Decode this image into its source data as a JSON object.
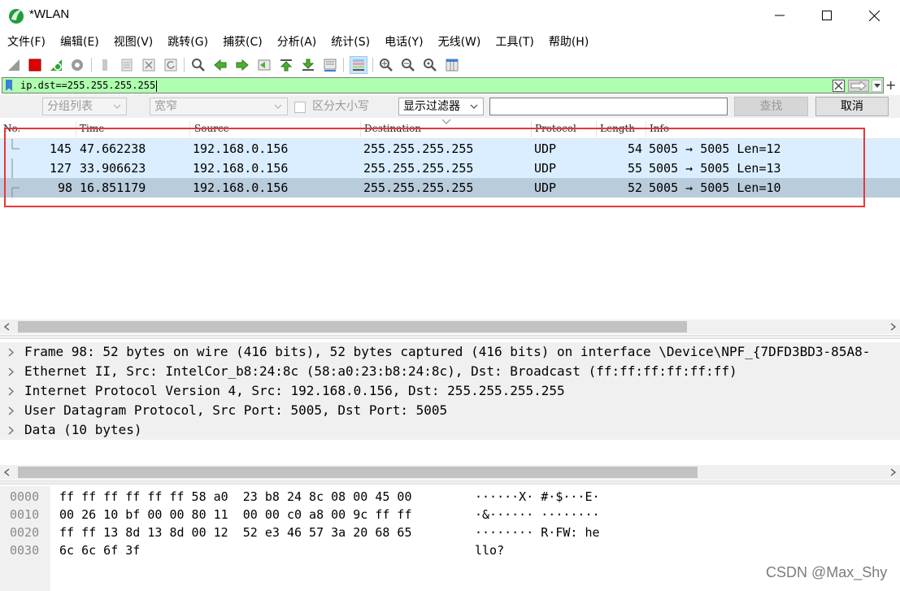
{
  "window": {
    "title": "*WLAN"
  },
  "menu": [
    {
      "label": "文件(F)"
    },
    {
      "label": "编辑(E)"
    },
    {
      "label": "视图(V)"
    },
    {
      "label": "跳转(G)"
    },
    {
      "label": "捕获(C)"
    },
    {
      "label": "分析(A)"
    },
    {
      "label": "统计(S)"
    },
    {
      "label": "电话(Y)"
    },
    {
      "label": "无线(W)"
    },
    {
      "label": "工具(T)"
    },
    {
      "label": "帮助(H)"
    }
  ],
  "toolbar": {
    "icons": [
      "shark-fin-start-icon",
      "stop-capture-icon",
      "restart-capture-icon",
      "capture-options-icon",
      "open-file-icon",
      "save-file-icon",
      "close-file-icon",
      "reload-file-icon",
      "find-packet-icon",
      "go-back-icon",
      "go-forward-icon",
      "go-to-packet-icon",
      "first-packet-icon",
      "last-packet-icon",
      "autoscroll-icon",
      "colorize-icon",
      "zoom-in-icon",
      "zoom-out-icon",
      "zoom-normal-icon",
      "resize-columns-icon"
    ]
  },
  "filter": {
    "value": "ip.dst==255.255.255.255",
    "status_color": "#afffaf"
  },
  "search": {
    "scope_label": "分组列表",
    "char_width_label": "宽窄",
    "case_label": "区分大小写",
    "type_label": "显示过滤器",
    "query": "",
    "find_label": "查找",
    "cancel_label": "取消"
  },
  "packet_list": {
    "columns": [
      "No.",
      "Time",
      "Source",
      "Destination",
      "Protocol",
      "Length",
      "Info"
    ],
    "rows": [
      {
        "no": "145",
        "time": "47.662238",
        "source": "192.168.0.156",
        "destination": "255.255.255.255",
        "protocol": "UDP",
        "length": "54",
        "info": "5005 → 5005 Len=12"
      },
      {
        "no": "127",
        "time": "33.906623",
        "source": "192.168.0.156",
        "destination": "255.255.255.255",
        "protocol": "UDP",
        "length": "55",
        "info": "5005 → 5005 Len=13"
      },
      {
        "no": "98",
        "time": "16.851179",
        "source": "192.168.0.156",
        "destination": "255.255.255.255",
        "protocol": "UDP",
        "length": "52",
        "info": "5005 → 5005 Len=10"
      }
    ],
    "selected_row": 2,
    "row_color": "#daeeff",
    "selected_color": "#b9ccdc",
    "highlight_box_color": "#e8363a"
  },
  "details": [
    {
      "label": "Frame 98: 52 bytes on wire (416 bits), 52 bytes captured (416 bits) on interface \\Device\\NPF_{7DFD3BD3-85A8-"
    },
    {
      "label": "Ethernet II, Src: IntelCor_b8:24:8c (58:a0:23:b8:24:8c), Dst: Broadcast (ff:ff:ff:ff:ff:ff)"
    },
    {
      "label": "Internet Protocol Version 4, Src: 192.168.0.156, Dst: 255.255.255.255"
    },
    {
      "label": "User Datagram Protocol, Src Port: 5005, Dst Port: 5005"
    },
    {
      "label": "Data (10 bytes)"
    }
  ],
  "bytes": [
    {
      "offset": "0000",
      "hex": "ff ff ff ff ff ff 58 a0  23 b8 24 8c 08 00 45 00",
      "ascii": "······X· #·$···E·"
    },
    {
      "offset": "0010",
      "hex": "00 26 10 bf 00 00 80 11  00 00 c0 a8 00 9c ff ff",
      "ascii": "·&······ ········"
    },
    {
      "offset": "0020",
      "hex": "ff ff 13 8d 13 8d 00 12  52 e3 46 57 3a 20 68 65",
      "ascii": "········ R·FW: he"
    },
    {
      "offset": "0030",
      "hex": "6c 6c 6f 3f",
      "ascii": "llo?"
    }
  ],
  "watermark": "CSDN @Max_Shy"
}
